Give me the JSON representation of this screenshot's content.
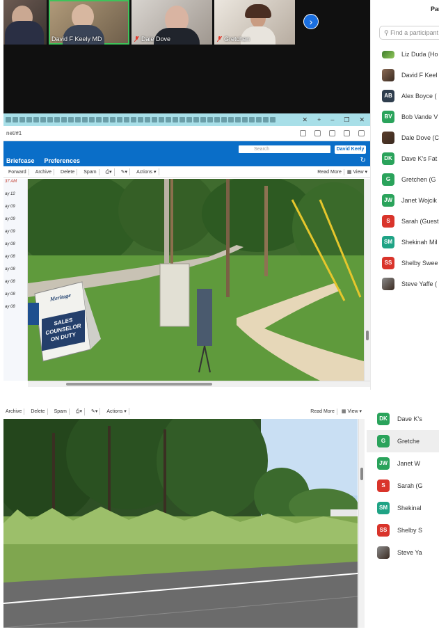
{
  "video_strip": {
    "tiles": [
      {
        "name": ""
      },
      {
        "name": "David F Keely MD"
      },
      {
        "name": "Dale Dove"
      },
      {
        "name": "Gretchen"
      }
    ],
    "next_icon": "chevron-right-icon"
  },
  "browser": {
    "address": "net/#1",
    "tabs": [
      "Briefcase",
      "Preferences"
    ],
    "search_placeholder": "Search",
    "user": "David Keely",
    "actions": [
      "Forward",
      "Archive",
      "Delete",
      "Spam",
      "Actions"
    ],
    "read_more": "Read More",
    "view": "View",
    "messages": [
      "ay 12",
      "ay 09",
      "ay 09",
      "ay 09",
      "ay 08",
      "ay 08",
      "ay 08",
      "ay 08",
      "ay 08",
      "ay 08"
    ],
    "message_header": "37 AM"
  },
  "sign": {
    "brand": "Meritage",
    "line1": "SALES",
    "line2": "COUNSELOR",
    "line3": "ON DUTY"
  },
  "participants": {
    "title": "Par",
    "search_placeholder": "Find a participant",
    "list": [
      {
        "initials": "",
        "name": "Liz Duda (Ho",
        "color": "#3f7e2e",
        "photo": true,
        "liz": true
      },
      {
        "initials": "",
        "name": "David F Keel",
        "color": "#8a6a55",
        "photo": true
      },
      {
        "initials": "AB",
        "name": "Alex Boyce (",
        "color": "#2f3e4e"
      },
      {
        "initials": "BV",
        "name": "Bob Vande V",
        "color": "#2aa35b"
      },
      {
        "initials": "",
        "name": "Dale Dove (C",
        "color": "#5a3d2b",
        "photo": true
      },
      {
        "initials": "DK",
        "name": "Dave K's Fat",
        "color": "#2aa35b"
      },
      {
        "initials": "G",
        "name": "Gretchen (G",
        "color": "#2aa35b"
      },
      {
        "initials": "JW",
        "name": "Janet Wojcik",
        "color": "#2aa35b"
      },
      {
        "initials": "S",
        "name": "Sarah (Guest",
        "color": "#d9342b"
      },
      {
        "initials": "SM",
        "name": "Shekinah Mil",
        "color": "#1fa385"
      },
      {
        "initials": "SS",
        "name": "Shelby Swee",
        "color": "#d9342b"
      },
      {
        "initials": "",
        "name": "Steve Yaffe (",
        "color": "#8a8a8a",
        "photo": true
      }
    ]
  },
  "bottom": {
    "actions": [
      "Archive",
      "Delete",
      "Spam",
      "Actions"
    ],
    "read_more": "Read More",
    "view": "View",
    "participants": [
      {
        "initials": "DK",
        "name": "Dave K's",
        "color": "#2aa35b"
      },
      {
        "initials": "G",
        "name": "Gretche",
        "color": "#2aa35b",
        "highlight": true
      },
      {
        "initials": "JW",
        "name": "Janet W",
        "color": "#2aa35b"
      },
      {
        "initials": "S",
        "name": "Sarah (G",
        "color": "#d9342b"
      },
      {
        "initials": "SM",
        "name": "Shekinal",
        "color": "#1fa385"
      },
      {
        "initials": "SS",
        "name": "Shelby S",
        "color": "#d9342b"
      },
      {
        "initials": "",
        "name": "Steve Ya",
        "color": "#8a8a8a",
        "photo": true
      }
    ]
  }
}
